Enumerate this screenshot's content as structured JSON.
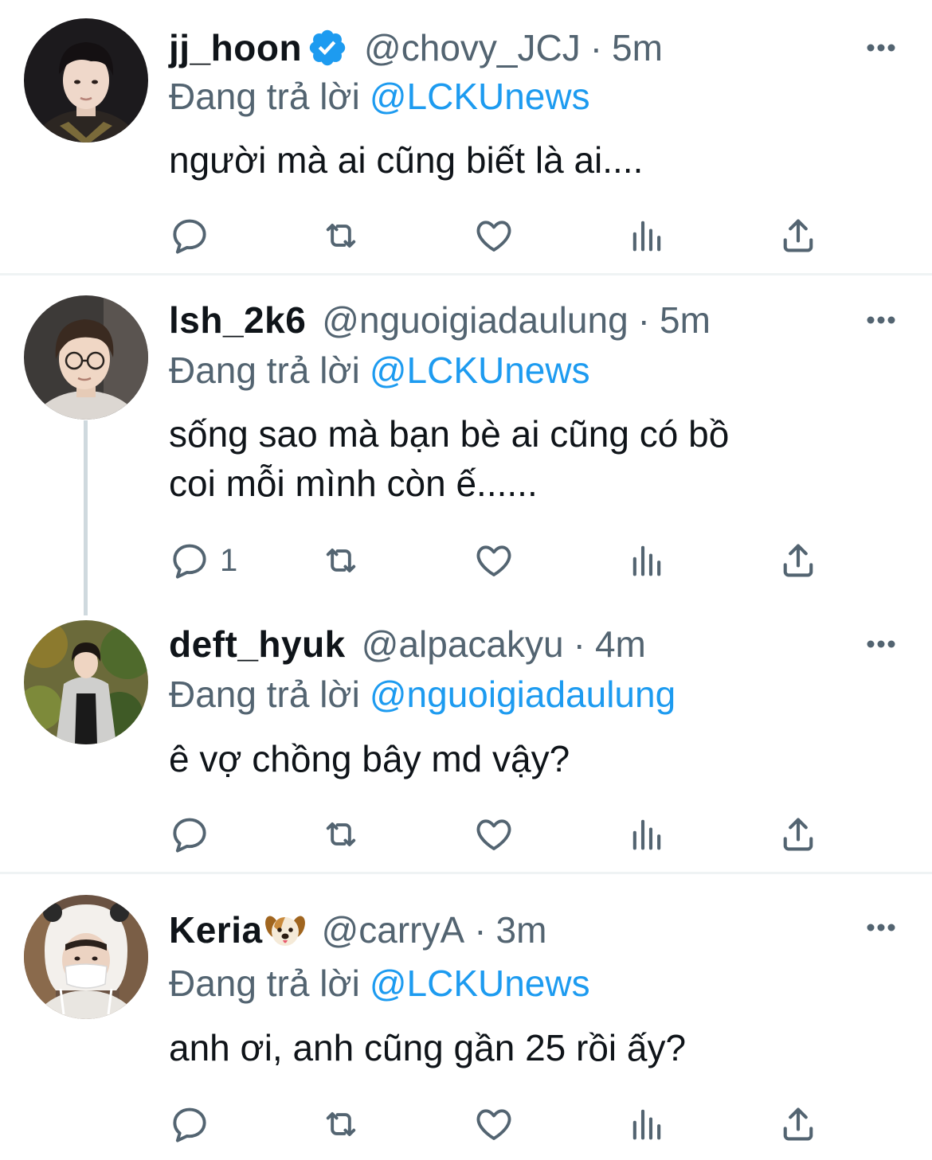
{
  "colors": {
    "text": "#0f1419",
    "secondary": "#536471",
    "link": "#1d9bf0",
    "divider": "#eff3f4",
    "thread_line": "#cfd9de"
  },
  "tweets": [
    {
      "name": "jj_hoon",
      "verified": true,
      "handle": "@chovy_JCJ",
      "sep": "·",
      "time": "5m",
      "reply_prefix": "Đang trả lời",
      "reply_to": "@LCKUnews",
      "text": "người mà ai cũng biết là ai....",
      "reply_count": ""
    },
    {
      "name": "lsh_2k6",
      "verified": false,
      "handle": "@nguoigiadaulung",
      "sep": "·",
      "time": "5m",
      "reply_prefix": "Đang trả lời",
      "reply_to": "@LCKUnews",
      "text": "sống sao mà bạn bè ai cũng có bồ\ncoi mỗi mình còn ế......",
      "reply_count": "1"
    },
    {
      "name": "deft_hyuk",
      "verified": false,
      "handle": "@alpacakyu",
      "sep": "·",
      "time": "4m",
      "reply_prefix": "Đang trả lời",
      "reply_to": "@nguoigiadaulung",
      "text": "ê vợ chồng bây md vậy?",
      "reply_count": ""
    },
    {
      "name": "Keria",
      "verified": false,
      "name_emoji": "dog-face-emoji",
      "handle": "@carryA",
      "sep": "·",
      "time": "3m",
      "reply_prefix": "Đang trả lời",
      "reply_to": "@LCKUnews",
      "text": "anh ơi, anh cũng gần 25 rồi ấy?",
      "reply_count": ""
    }
  ],
  "icons": {
    "reply": "speech-bubble-icon",
    "retweet": "retweet-icon",
    "like": "heart-icon",
    "views": "bar-chart-icon",
    "share": "share-upload-icon",
    "more": "more-dots-icon",
    "verified": "verified-badge-icon"
  }
}
